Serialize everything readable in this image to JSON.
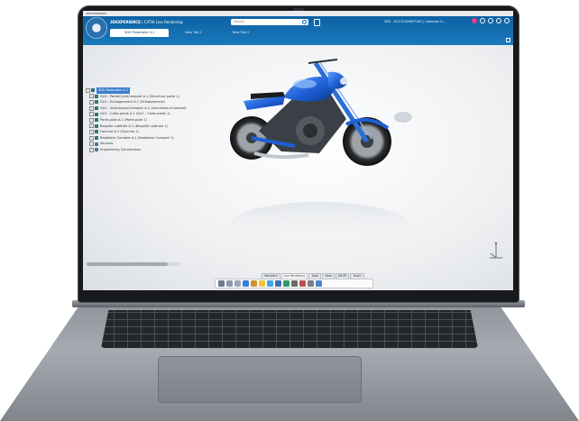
{
  "window": {
    "title": "3DEXPERIENCE"
  },
  "app": {
    "brand_strong": "3DEXPERIENCE",
    "brand_rest": " | CATIA Live Rendering"
  },
  "tabs": [
    {
      "label": "3DS Motorbike A.1",
      "active": true
    },
    {
      "label": "New Tab 1",
      "active": false
    },
    {
      "label": "New Tab 2",
      "active": false
    }
  ],
  "search": {
    "placeholder": "Search"
  },
  "user": {
    "text": "3DS - R1132100637187 | Common S..."
  },
  "tree": [
    {
      "label": "3DS Motorbike A.1",
      "level": 0,
      "icon": "product-icon",
      "root": true
    },
    {
      "label": "GLO - PartieCycleComplet A.1 (Structure parte 1)",
      "level": 1,
      "icon": "product-icon"
    },
    {
      "label": "GLO - Echappement A.1 (Echappement)",
      "level": 1,
      "icon": "product-icon"
    },
    {
      "label": "GLO - AmortisseurComplet A.1 (AmortisseurComplet)",
      "level": 1,
      "icon": "product-icon"
    },
    {
      "label": "GLO - Cales pieds A.1 (GLO - Cales pieds 1)",
      "level": 1,
      "icon": "product-icon"
    },
    {
      "label": "Porte-pute A.1 (Porte-pute 1)",
      "level": 1,
      "icon": "product-icon"
    },
    {
      "label": "Bequille Latérale A.1 (Bequille Latérale 1)",
      "level": 1,
      "icon": "product-icon"
    },
    {
      "label": "Fourche A.1 (Fourche 1)",
      "level": 1,
      "icon": "product-icon"
    },
    {
      "label": "Radiateur Complet A.1 (Radiateur Complet 1)",
      "level": 1,
      "icon": "product-icon"
    },
    {
      "label": "Sources",
      "level": 1,
      "icon": "gear-icon"
    },
    {
      "label": "Engineering Connections",
      "level": 1,
      "icon": "gear-icon"
    }
  ],
  "context_tabs": [
    {
      "label": "Standard",
      "active": false
    },
    {
      "label": "Live Rendering",
      "active": true
    },
    {
      "label": "Tools",
      "active": false
    },
    {
      "label": "View",
      "active": false
    },
    {
      "label": "AR-VR",
      "active": false
    },
    {
      "label": "Touch",
      "active": false
    }
  ],
  "action_icons": [
    {
      "name": "zoom-icon",
      "color": "#6b7a8c"
    },
    {
      "name": "fit-all-icon",
      "color": "#8a99aa"
    },
    {
      "name": "select-icon",
      "color": "#9aa7b5"
    },
    {
      "name": "material-icon",
      "color": "#2f7fd4"
    },
    {
      "name": "ambiance-icon",
      "color": "#d08f2a"
    },
    {
      "name": "light-icon",
      "color": "#f0c23a"
    },
    {
      "name": "camera-icon",
      "color": "#4aa3df"
    },
    {
      "name": "render-icon",
      "color": "#3c6fb5"
    },
    {
      "name": "image-icon",
      "color": "#2f9a6b"
    },
    {
      "name": "video-icon",
      "color": "#6a6a6a"
    },
    {
      "name": "stickers-icon",
      "color": "#c05050"
    },
    {
      "name": "settings-icon",
      "color": "#7b7f86"
    },
    {
      "name": "help-icon",
      "color": "#4a86c8"
    }
  ],
  "colors": {
    "accent": "#1a78bd",
    "model": "#1f5fd6"
  }
}
